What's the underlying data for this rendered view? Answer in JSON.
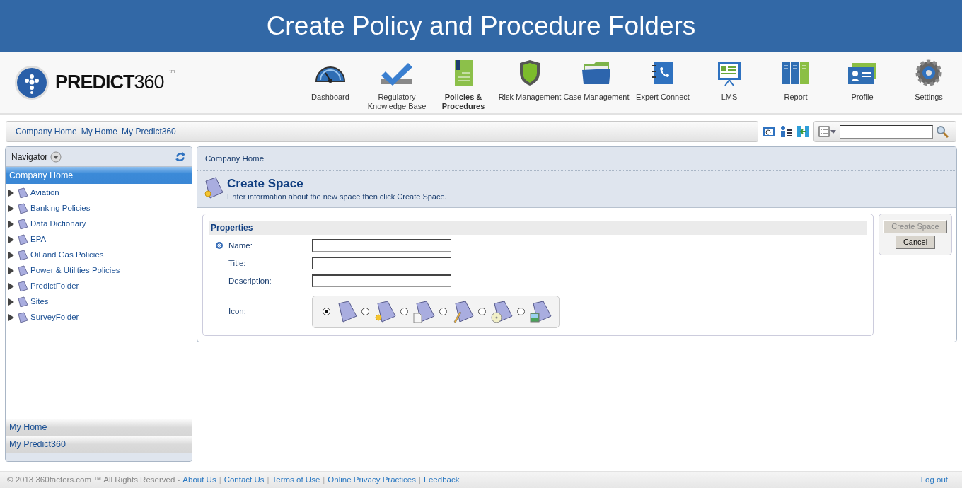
{
  "banner": {
    "title": "Create Policy and Procedure Folders"
  },
  "header": {
    "logo_text": "PREDICT",
    "logo_number": "360",
    "logo_mark": "tm",
    "nav": [
      {
        "label": "Dashboard",
        "selected": false
      },
      {
        "label": "Regulatory Knowledge Base",
        "selected": false
      },
      {
        "label": "Policies & Procedures",
        "selected": true
      },
      {
        "label": "Risk Management",
        "selected": false
      },
      {
        "label": "Case Management",
        "selected": false
      },
      {
        "label": "Expert Connect",
        "selected": false
      },
      {
        "label": "LMS",
        "selected": false
      },
      {
        "label": "Report",
        "selected": false
      },
      {
        "label": "Profile",
        "selected": false
      },
      {
        "label": "Settings",
        "selected": false
      }
    ]
  },
  "quick_links": [
    "Company Home",
    "My Home",
    "My Predict360"
  ],
  "navigator": {
    "title": "Navigator",
    "sections": [
      {
        "label": "Company Home",
        "selected": true,
        "items": [
          {
            "label": "Aviation",
            "expanded": false
          },
          {
            "label": "Banking Policies",
            "expanded": false
          },
          {
            "label": "Data Dictionary",
            "expanded": false
          },
          {
            "label": "EPA",
            "expanded": false
          },
          {
            "label": "Oil and Gas Policies",
            "expanded": false
          },
          {
            "label": "Power & Utilities Policies",
            "expanded": false
          },
          {
            "label": "PredictFolder",
            "expanded": false
          },
          {
            "label": "Sites",
            "expanded": false
          },
          {
            "label": "SurveyFolder",
            "expanded": false
          }
        ]
      },
      {
        "label": "My Home",
        "selected": false
      },
      {
        "label": "My Predict360",
        "selected": false
      }
    ]
  },
  "content": {
    "breadcrumb": "Company Home",
    "title": "Create Space",
    "subtitle": "Enter information about the new space then click Create Space.",
    "properties": {
      "heading": "Properties",
      "fields": [
        {
          "label": "Name:",
          "required": true
        },
        {
          "label": "Title:",
          "required": false
        },
        {
          "label": "Description:",
          "required": false
        }
      ],
      "icon_label": "Icon:",
      "icon_options": [
        {
          "selected": true
        },
        {
          "selected": false
        },
        {
          "selected": false
        },
        {
          "selected": false
        },
        {
          "selected": false
        },
        {
          "selected": false
        }
      ]
    },
    "buttons": [
      {
        "label": "Create Space",
        "disabled": true
      },
      {
        "label": "Cancel",
        "disabled": false
      }
    ]
  },
  "footer": {
    "copyright": "© 2013 360factors.com ™ All Rights Reserved -",
    "items": [
      {
        "kind": "link",
        "text": "About Us"
      },
      {
        "kind": "separator",
        "text": "|"
      },
      {
        "kind": "link",
        "text": "Contact Us"
      },
      {
        "kind": "separator",
        "text": "|"
      },
      {
        "kind": "link",
        "text": "Terms of Use"
      },
      {
        "kind": "separator",
        "text": "|"
      },
      {
        "kind": "link",
        "text": "Online Privacy Practices"
      },
      {
        "kind": "separator",
        "text": "|"
      },
      {
        "kind": "link",
        "text": "Feedback"
      }
    ],
    "logout": "Log out"
  }
}
